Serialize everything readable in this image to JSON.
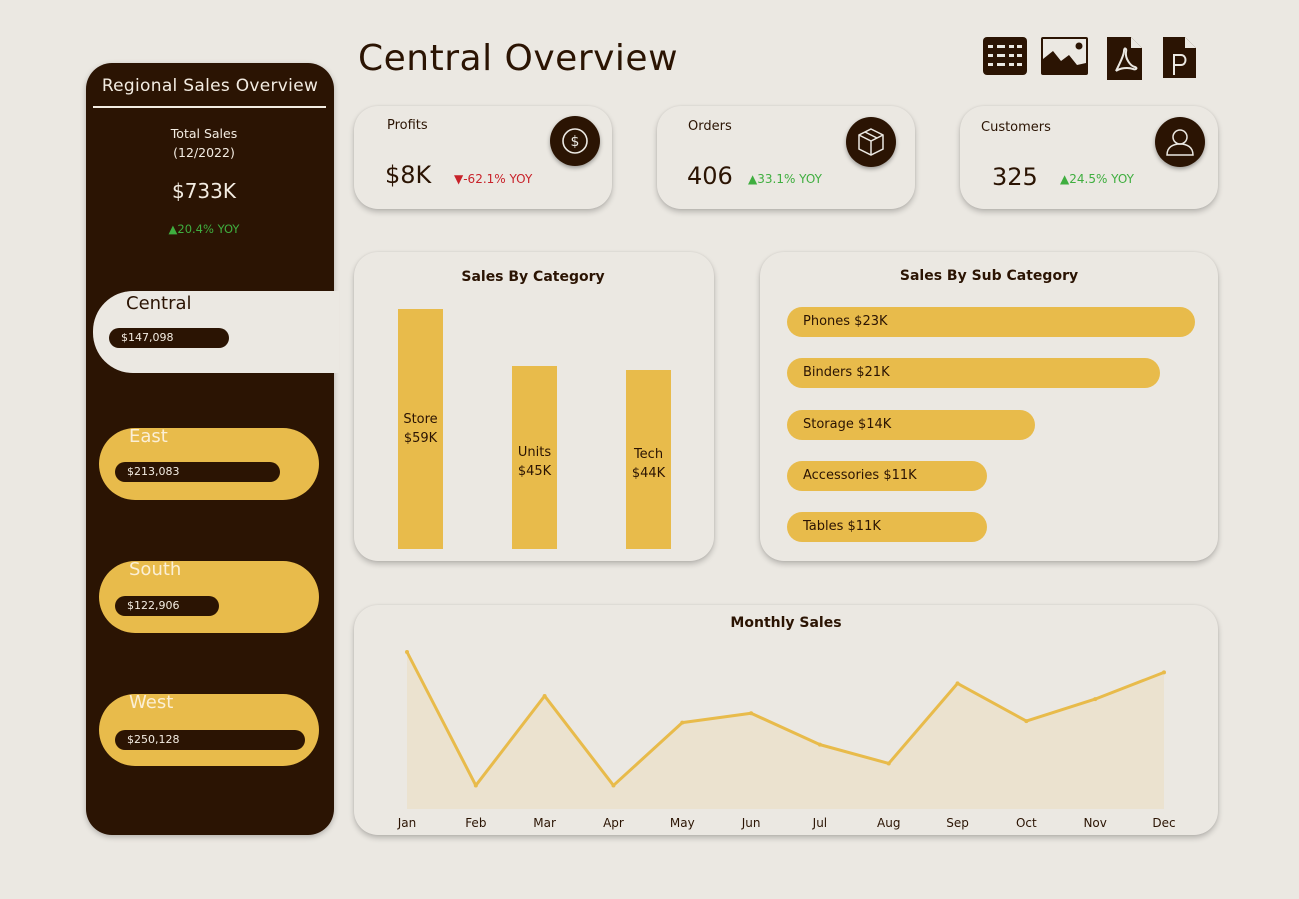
{
  "sidebar": {
    "title": "Regional Sales Overview",
    "total_label": "Total Sales\n(12/2022)",
    "total_value": "$733K",
    "total_yoy": "▲20.4% YOY",
    "regions": [
      {
        "name": "Central",
        "value": "$147,098",
        "active": true
      },
      {
        "name": "East",
        "value": "$213,083",
        "active": false
      },
      {
        "name": "South",
        "value": "$122,906",
        "active": false
      },
      {
        "name": "West",
        "value": "$250,128",
        "active": false
      }
    ]
  },
  "header": {
    "title": "Central Overview",
    "tools": [
      "table-view-icon",
      "chart-image-icon",
      "pdf-export-icon",
      "powerpoint-export-icon"
    ]
  },
  "kpis": [
    {
      "label": "Profits",
      "value": "$8K",
      "yoy": "▼-62.1% YOY",
      "direction": "down",
      "icon": "dollar-icon"
    },
    {
      "label": "Orders",
      "value": "406",
      "yoy": "▲33.1% YOY",
      "direction": "up",
      "icon": "box-icon"
    },
    {
      "label": "Customers",
      "value": "325",
      "yoy": "▲24.5% YOY",
      "direction": "up",
      "icon": "user-icon"
    }
  ],
  "colors": {
    "background": "#ebe8e2",
    "dark": "#2b1403",
    "accent": "#e8bb4b",
    "up": "#3fae3f",
    "down": "#c8222a"
  },
  "chart_data": [
    {
      "type": "bar",
      "title": "Sales By Category",
      "categories": [
        "Store",
        "Units",
        "Tech"
      ],
      "values": [
        59,
        45,
        44
      ],
      "labels": [
        "Store\n$59K",
        "Units\n$45K",
        "Tech\n$44K"
      ],
      "unit": "$K",
      "ylim": [
        0,
        59
      ]
    },
    {
      "type": "bar",
      "orientation": "horizontal",
      "title": "Sales By Sub Category",
      "categories": [
        "Phones",
        "Binders",
        "Storage",
        "Accessories",
        "Tables"
      ],
      "values": [
        23,
        21,
        14,
        11,
        11
      ],
      "labels": [
        "Phones $23K",
        "Binders $21K",
        "Storage $14K",
        "Accessories $11K",
        "Tables $11K"
      ],
      "unit": "$K"
    },
    {
      "type": "area",
      "title": "Monthly Sales",
      "categories": [
        "Jan",
        "Feb",
        "Mar",
        "Apr",
        "May",
        "Jun",
        "Jul",
        "Aug",
        "Sep",
        "Oct",
        "Nov",
        "Dec"
      ],
      "values": [
        100,
        15,
        72,
        15,
        55,
        61,
        41,
        29,
        80,
        56,
        70,
        87
      ],
      "ylim": [
        0,
        100
      ],
      "grid": false
    }
  ]
}
